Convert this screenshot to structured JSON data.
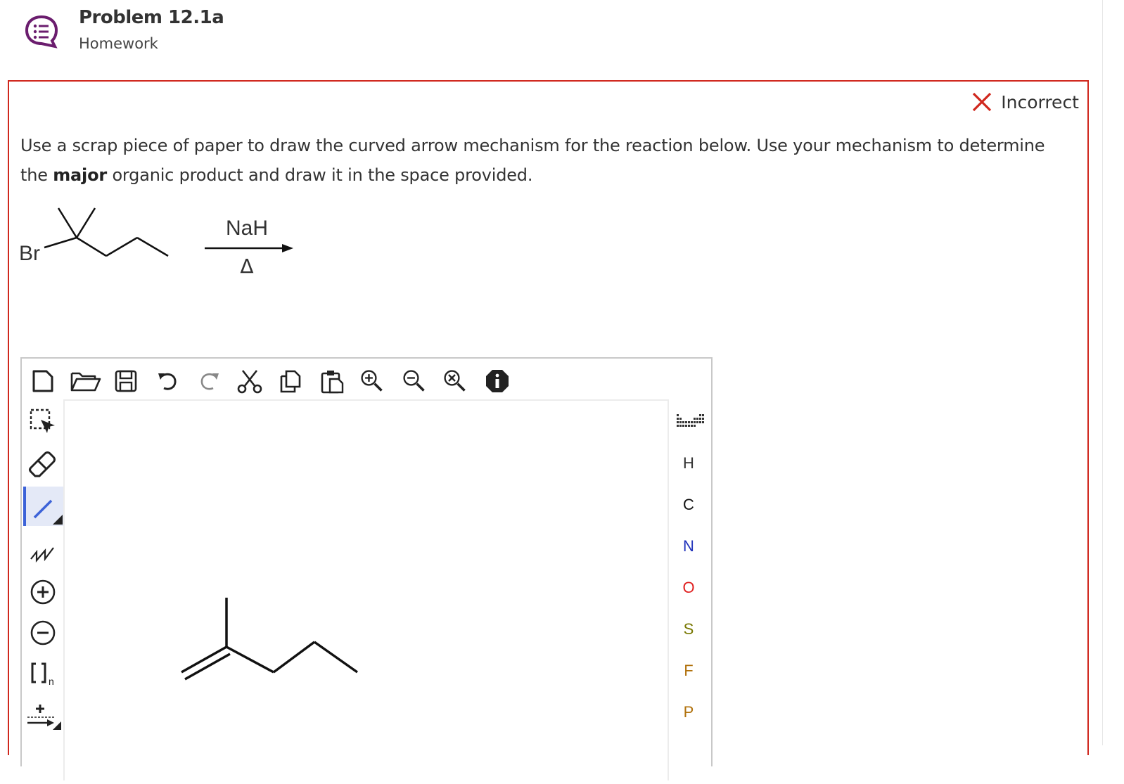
{
  "header": {
    "title": "Problem 12.1a",
    "subtitle": "Homework",
    "icon": "chat-list-icon"
  },
  "status": {
    "label": "Incorrect",
    "color": "#d0271d"
  },
  "question": {
    "part1": "Use a scrap piece of paper to draw the curved arrow mechanism for the reaction below. Use your mechanism to determine the",
    "bold": "major",
    "part2": "organic product and draw it in the space provided."
  },
  "reaction": {
    "reactant_label": "Br",
    "reagent": "NaH",
    "condition": "Δ"
  },
  "toolbar_top": [
    "new-document-icon",
    "open-folder-icon",
    "save-icon",
    "undo-icon",
    "redo-icon",
    "cut-icon",
    "copy-icon",
    "paste-icon",
    "zoom-in-icon",
    "zoom-out-icon",
    "zoom-reset-icon",
    "info-icon"
  ],
  "toolbar_left": [
    "select-icon",
    "eraser-icon",
    "single-bond-icon",
    "chain-icon",
    "charge-plus-icon",
    "charge-minus-icon",
    "bracket-icon",
    "arrow-icon"
  ],
  "elements": [
    {
      "symbol": "H",
      "color": "#333333"
    },
    {
      "symbol": "C",
      "color": "#111111"
    },
    {
      "symbol": "N",
      "color": "#2233bb"
    },
    {
      "symbol": "O",
      "color": "#e02020"
    },
    {
      "symbol": "S",
      "color": "#777700"
    },
    {
      "symbol": "F",
      "color": "#b0700a"
    },
    {
      "symbol": "P",
      "color": "#b0700a"
    }
  ],
  "bracket_subscript": "n"
}
